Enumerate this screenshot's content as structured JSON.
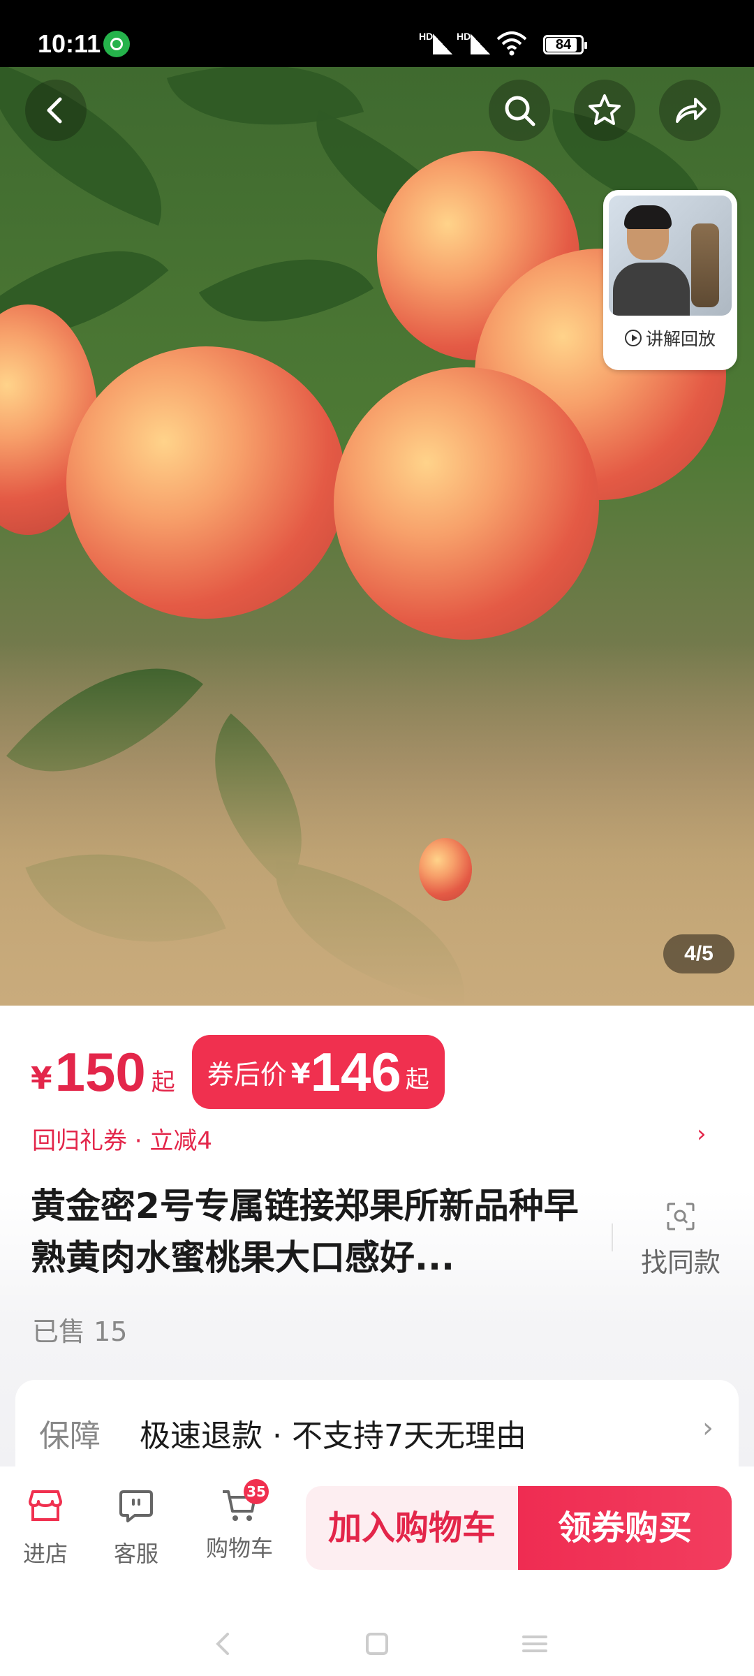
{
  "status_bar": {
    "time": "10:11",
    "signal_1_label": "HD",
    "signal_2_label": "HD",
    "battery_level": "84"
  },
  "hero": {
    "image_counter": "4/5",
    "video_label": "讲解回放",
    "icons": {
      "back": "back-arrow-icon",
      "search": "search-icon",
      "favorite": "star-icon",
      "share": "share-icon"
    }
  },
  "price": {
    "currency": "¥",
    "amount": "150",
    "suffix": "起",
    "coupon_label": "券后价",
    "coupon_currency": "¥",
    "coupon_amount": "146",
    "coupon_suffix": "起"
  },
  "promo_text": "回归礼券 · 立减4",
  "product": {
    "title": "黄金密2号专属链接郑果所新品种早熟黄肉水蜜桃果大口感好...",
    "find_same_label": "找同款",
    "sold_text": "已售 15"
  },
  "guarantee": {
    "label": "保障",
    "text": "极速退款 · 不支持7天无理由"
  },
  "action_bar": {
    "store_label": "进店",
    "service_label": "客服",
    "cart_label": "购物车",
    "cart_badge": "35",
    "add_cart_label": "加入购物车",
    "buy_label": "领券购买"
  },
  "colors": {
    "accent": "#f0304f",
    "price_red": "#e3264a"
  }
}
